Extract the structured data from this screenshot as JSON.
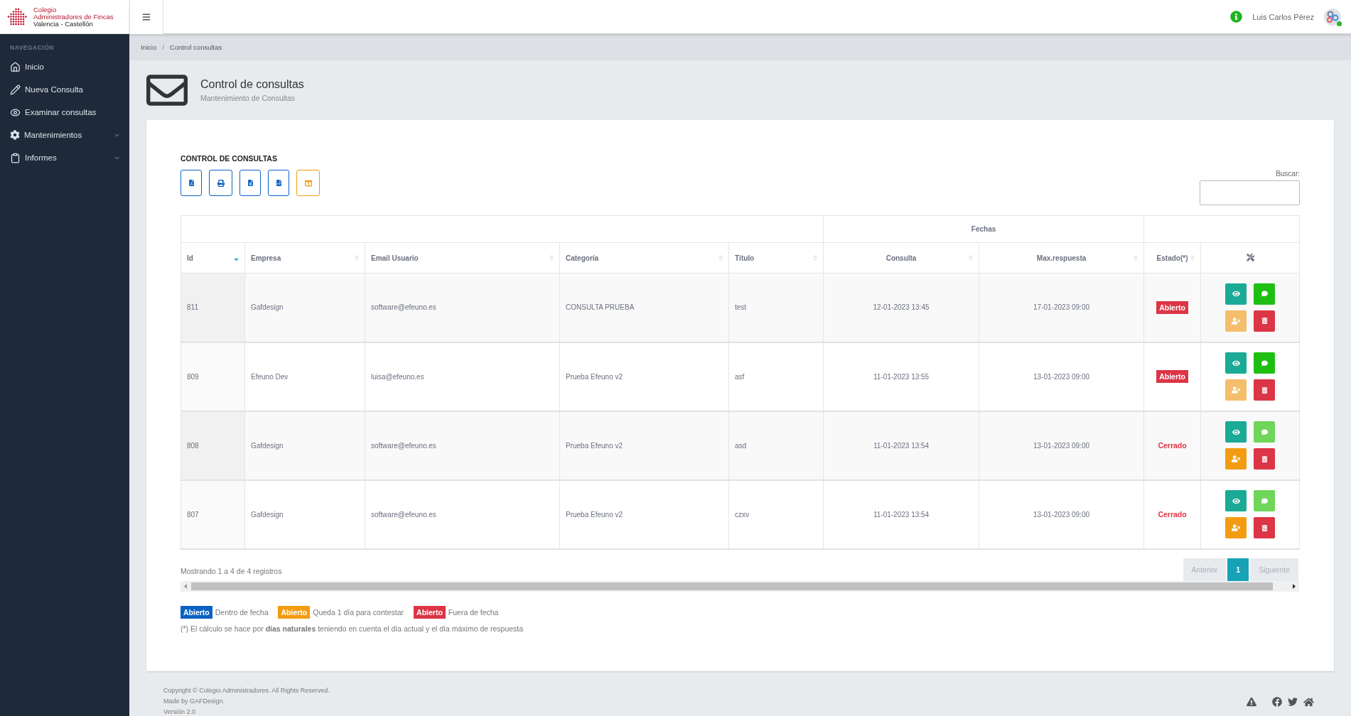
{
  "brand": {
    "lines": [
      "Colegio",
      "Administradores de Fincas",
      "Valencia - Castellón"
    ]
  },
  "user": {
    "name": "Luis Carlos Pérez",
    "online": true
  },
  "sidebar": {
    "heading": "NAVEGACIÓN",
    "items": [
      {
        "label": "Inicio",
        "expandable": false,
        "selected": false
      },
      {
        "label": "Nueva Consulta",
        "expandable": false,
        "selected": false
      },
      {
        "label": "Examinar consultas",
        "expandable": false,
        "selected": false
      },
      {
        "label": "Mantenimientos",
        "expandable": true,
        "selected": false
      },
      {
        "label": "Informes",
        "expandable": true,
        "selected": false
      }
    ]
  },
  "breadcrumb": {
    "separator": "/",
    "items": [
      "Inicio",
      "Control consultas"
    ]
  },
  "page": {
    "title": "Control de consultas",
    "subtitle": "Mantenimiento de Consultas"
  },
  "card": {
    "title": "CONTROL DE CONSULTAS",
    "export_buttons": [
      {
        "kind": "pdf"
      },
      {
        "kind": "print"
      },
      {
        "kind": "excel"
      },
      {
        "kind": "csv"
      },
      {
        "kind": "columns"
      }
    ],
    "search": {
      "label": "Buscar:"
    },
    "table": {
      "group_header": "Fechas",
      "columns": [
        {
          "label": "Id",
          "sortable": true,
          "sorted": true
        },
        {
          "label": "Empresa",
          "sortable": true,
          "sorted": false
        },
        {
          "label": "Email Usuario",
          "sortable": true,
          "sorted": false
        },
        {
          "label": "Categoría",
          "sortable": true,
          "sorted": false
        },
        {
          "label": "Título",
          "sortable": true,
          "sorted": false
        },
        {
          "label": "Consulta",
          "sortable": true,
          "sorted": false
        },
        {
          "label": "Max.respuesta",
          "sortable": true,
          "sorted": false
        },
        {
          "label": "Estado(*)",
          "sortable": true,
          "sorted": false
        }
      ],
      "rows": [
        {
          "cells": [
            "811",
            "Gafdesign",
            "software@efeuno.es",
            "CONSULTA PRUEBA",
            "test",
            "12-01-2023 13:45",
            "17-01-2023 09:00"
          ],
          "status": {
            "label": "Abierto",
            "kind": "badge",
            "color": "#dc3545"
          },
          "reply_enabled": true,
          "reassign_enabled": false
        },
        {
          "cells": [
            "809",
            "Efeuno Dev",
            "luisa@efeuno.es",
            "Prueba Efeuno v2",
            "asf",
            "11-01-2023 13:55",
            "13-01-2023 09:00"
          ],
          "status": {
            "label": "Abierto",
            "kind": "badge",
            "color": "#dc3545"
          },
          "reply_enabled": true,
          "reassign_enabled": false
        },
        {
          "cells": [
            "808",
            "Gafdesign",
            "software@efeuno.es",
            "Prueba Efeuno v2",
            "asd",
            "11-01-2023 13:54",
            "13-01-2023 09:00"
          ],
          "status": {
            "label": "Cerrado",
            "kind": "text",
            "color": "#dc3545"
          },
          "reply_enabled": false,
          "reassign_enabled": true
        },
        {
          "cells": [
            "807",
            "Gafdesign",
            "software@efeuno.es",
            "Prueba Efeuno v2",
            "czxv",
            "11-01-2023 13:54",
            "13-01-2023 09:00"
          ],
          "status": {
            "label": "Cerrado",
            "kind": "text",
            "color": "#dc3545"
          },
          "reply_enabled": false,
          "reassign_enabled": true
        }
      ]
    },
    "info": "Mostrando 1 a 4 de 4 registros",
    "pagination": [
      {
        "label": "Anterior",
        "selected": false
      },
      {
        "label": "1",
        "selected": true
      },
      {
        "label": "Siguiente",
        "selected": false
      }
    ],
    "legend": [
      {
        "badge": "Abierto",
        "color": "#0b62c4",
        "text": "Dentro de fecha"
      },
      {
        "badge": "Abierto",
        "color": "#f39c12",
        "text": "Queda 1 día para contestar"
      },
      {
        "badge": "Abierto",
        "color": "#dc3545",
        "text": "Fuera de fecha"
      }
    ],
    "note": "(*) El cálculo se hace por **días naturales** teniendo en cuenta el día actual y el día máximo de respuesta"
  },
  "footer": {
    "lines": [
      "Copyright © Colegio Administradores. All Rights Reserved.",
      "Made by GAFDesign.",
      "Versión 2.0"
    ]
  }
}
